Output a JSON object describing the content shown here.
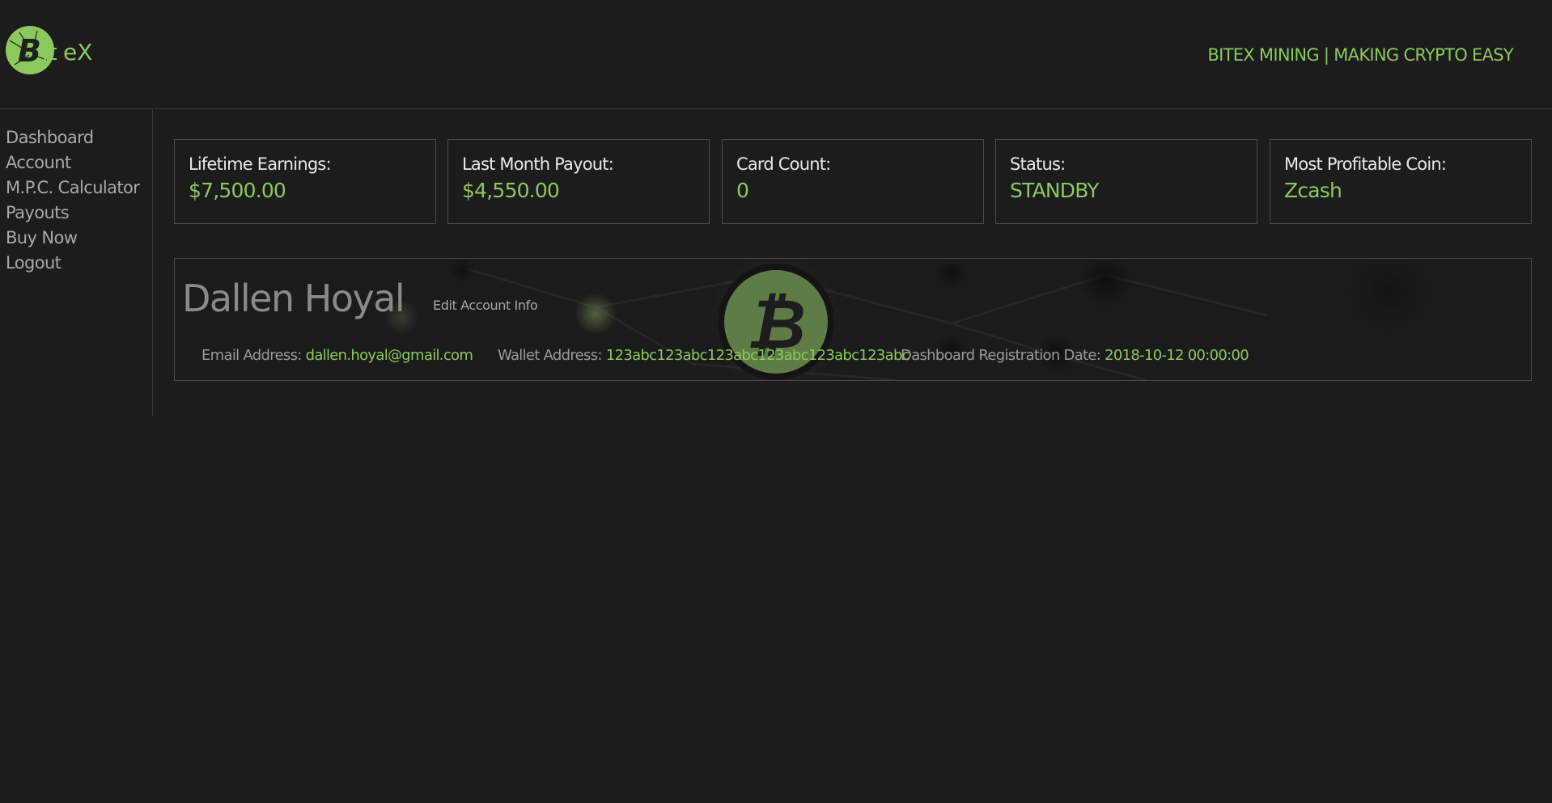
{
  "header": {
    "logo_text": "BiteX",
    "tagline": "BITEX MINING | MAKING CRYPTO EASY"
  },
  "sidebar": {
    "items": [
      {
        "label": "Dashboard"
      },
      {
        "label": "Account"
      },
      {
        "label": "M.P.C. Calculator"
      },
      {
        "label": "Payouts"
      },
      {
        "label": "Buy Now"
      },
      {
        "label": "Logout"
      }
    ]
  },
  "stats": [
    {
      "label": "Lifetime Earnings:",
      "value": "$7,500.00"
    },
    {
      "label": "Last Month Payout:",
      "value": "$4,550.00"
    },
    {
      "label": "Card Count:",
      "value": "0"
    },
    {
      "label": "Status:",
      "value": "STANDBY"
    },
    {
      "label": "Most Profitable Coin:",
      "value": "Zcash"
    }
  ],
  "account": {
    "name": "Dallen Hoyal",
    "edit_label": "Edit Account Info",
    "email_label": "Email Address:",
    "email": "dallen.hoyal@gmail.com",
    "wallet_label": "Wallet Address:",
    "wallet": "123abc123abc123abc123abc123abc123abc",
    "reg_label": "Dashboard Registration Date:",
    "reg_date": "2018-10-12 00:00:00"
  },
  "colors": {
    "accent": "#8cc95d",
    "background": "#1c1c1c",
    "border": "#4a4a4a"
  },
  "icons": {
    "logo": "bitcoin-logo-icon",
    "panel_background": "bitcoin-coin-icon"
  }
}
